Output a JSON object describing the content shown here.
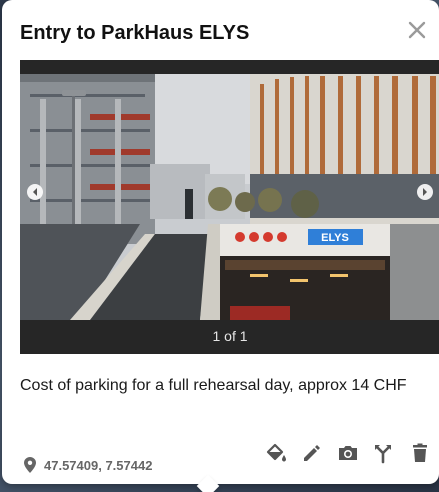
{
  "popup": {
    "title": "Entry to ParkHaus ELYS",
    "description": "Cost of parking for a full rehearsal day, approx 14 CHF",
    "coordinates": "47.57409, 7.57442"
  },
  "carousel": {
    "counter": "1 of 1",
    "photo_sign_text": "ELYS",
    "prev_icon": "chevron-left-icon",
    "next_icon": "chevron-right-icon"
  },
  "actions": [
    {
      "icon": "paint-bucket-icon"
    },
    {
      "icon": "pencil-icon"
    },
    {
      "icon": "camera-icon"
    },
    {
      "icon": "branch-icon"
    },
    {
      "icon": "trash-icon"
    }
  ],
  "colors": {
    "icon": "#555555",
    "close": "#9a9a9a",
    "carousel_bg": "#262626",
    "sign_blue": "#2f7fd8"
  }
}
